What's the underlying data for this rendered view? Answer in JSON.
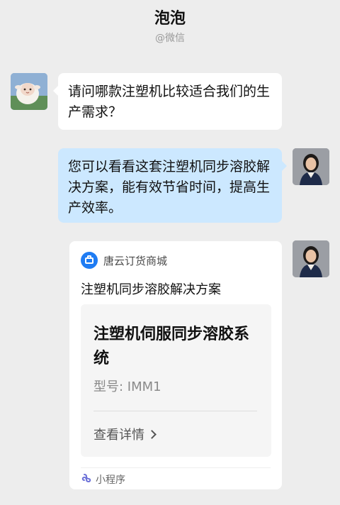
{
  "header": {
    "title": "泡泡",
    "subtitle": "@微信"
  },
  "messages": [
    {
      "side": "left",
      "text": "请问哪款注塑机比较适合我们的生产需求？",
      "avatar": "lamb-avatar"
    },
    {
      "side": "right",
      "text": "您可以看看这套注塑机同步溶胶解决方案，能有效节省时间，提高生产效率。",
      "avatar": "woman-avatar"
    }
  ],
  "mini_program_card": {
    "app_name": "唐云订货商城",
    "title": "注塑机同步溶胶解决方案",
    "product_name": "注塑机伺服同步溶胶系统",
    "model": "型号: IMM1",
    "detail_link": "查看详情",
    "footer_label": "小程序",
    "app_icon": "shopping-bag-icon",
    "footer_icon": "mini-program-icon"
  },
  "colors": {
    "background": "#ededed",
    "bubble_left": "#ffffff",
    "bubble_right": "#cce8ff",
    "app_icon": "#1f7cf3"
  }
}
